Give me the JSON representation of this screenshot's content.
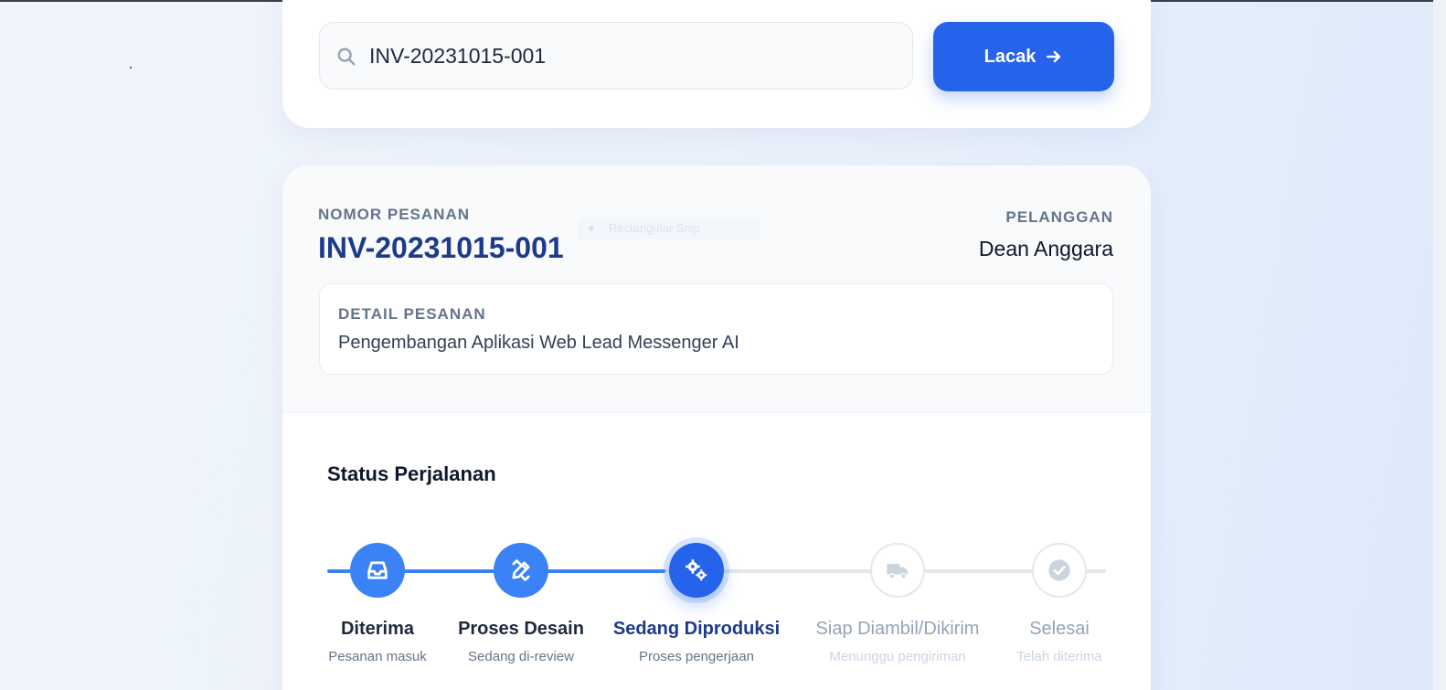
{
  "search": {
    "value": "INV-20231015-001",
    "button_label": "Lacak"
  },
  "order": {
    "number_label": "NOMOR PESANAN",
    "number": "INV-20231015-001",
    "customer_label": "PELANGGAN",
    "customer_name": "Dean Anggara",
    "detail_label": "DETAIL PESANAN",
    "detail_text": "Pengembangan Aplikasi Web Lead Messenger AI",
    "ghost_badge": "Rectangular Snip"
  },
  "status": {
    "title": "Status Perjalanan",
    "steps": [
      {
        "title": "Diterima",
        "subtitle": "Pesanan masuk",
        "state": "done",
        "icon": "inbox-icon"
      },
      {
        "title": "Proses Desain",
        "subtitle": "Sedang di-review",
        "state": "done",
        "icon": "pencil-ruler-icon"
      },
      {
        "title": "Sedang Diproduksi",
        "subtitle": "Proses pengerjaan",
        "state": "active",
        "icon": "gears-icon"
      },
      {
        "title": "Siap Diambil/Dikirim",
        "subtitle": "Menunggu pengiriman",
        "state": "pending",
        "icon": "truck-icon"
      },
      {
        "title": "Selesai",
        "subtitle": "Telah diterima",
        "state": "pending",
        "icon": "check-circle-icon"
      }
    ]
  },
  "colors": {
    "primary": "#2563eb",
    "progress": "#3b82f6",
    "heading_blue": "#1e3a8a",
    "muted": "#64748b",
    "pending": "#94a3b8"
  }
}
